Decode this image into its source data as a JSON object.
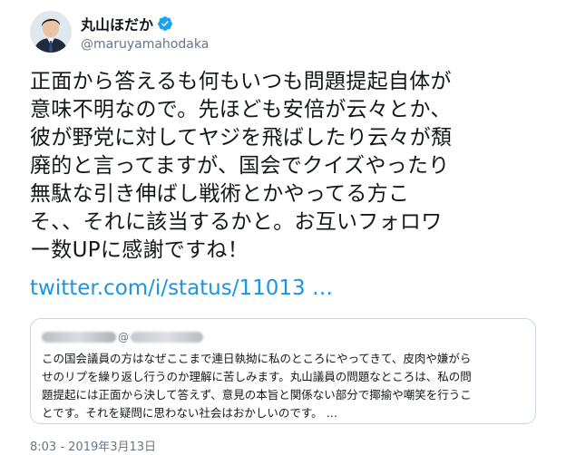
{
  "author": {
    "display_name": "丸山ほだか",
    "handle": "@maruyamahodaka",
    "verified": true,
    "avatar_icon": "profile-photo",
    "verified_color": "#1da1f2"
  },
  "tweet": {
    "text": "正面から答えるも何もいつも問題提起自体が\n意味不明なので。先ほども安倍が云々とか、\n彼が野党に対してヤジを飛ばしたり云々が頽\n廃的と言ってますが、国会でクイズやったり\n無駄な引き伸ばし戦術とかやってる方こ\nそ、、それに該当するかと。お互いフォロワ\nー数UPに感謝ですね！",
    "link": "twitter.com/i/status/11013 …",
    "link_color": "#1b95e0"
  },
  "quote": {
    "at": "@",
    "text": "この国会議員の方はなぜここまで連日執拗に私のところにやってきて、皮肉や嫌がら\nせのリプを繰り返し行うのか理解に苦しみます。丸山議員の問題なところは、私の問\n題提起には正面から決して答えず、意見の本旨と関係ない部分で揶揄や嘲笑を行うこ\nとです。それを疑問に思わない社会はおかしいのです。 …"
  },
  "timestamp": "8:03 - 2019年3月13日"
}
